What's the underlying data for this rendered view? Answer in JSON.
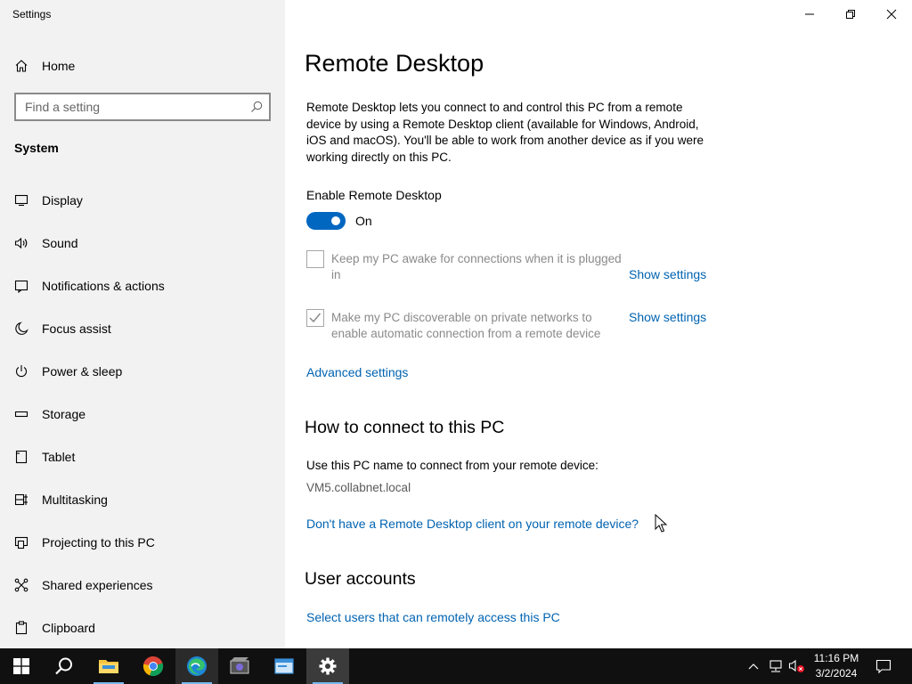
{
  "window": {
    "title": "Settings"
  },
  "sidebar": {
    "home_label": "Home",
    "search_placeholder": "Find a setting",
    "section_title": "System",
    "items": [
      {
        "label": "Display",
        "icon": "display-icon"
      },
      {
        "label": "Sound",
        "icon": "sound-icon"
      },
      {
        "label": "Notifications & actions",
        "icon": "notifications-icon"
      },
      {
        "label": "Focus assist",
        "icon": "moon-icon"
      },
      {
        "label": "Power & sleep",
        "icon": "power-icon"
      },
      {
        "label": "Storage",
        "icon": "storage-icon"
      },
      {
        "label": "Tablet",
        "icon": "tablet-icon"
      },
      {
        "label": "Multitasking",
        "icon": "multitasking-icon"
      },
      {
        "label": "Projecting to this PC",
        "icon": "projecting-icon"
      },
      {
        "label": "Shared experiences",
        "icon": "shared-experiences-icon"
      },
      {
        "label": "Clipboard",
        "icon": "clipboard-icon"
      }
    ]
  },
  "main": {
    "title": "Remote Desktop",
    "description": "Remote Desktop lets you connect to and control this PC from a remote device by using a Remote Desktop client (available for Windows, Android, iOS and macOS). You'll be able to work from another device as if you were working directly on this PC.",
    "enable_label": "Enable Remote Desktop",
    "toggle_state": "On",
    "keep_awake": {
      "text": "Keep my PC awake for connections when it is plugged in",
      "checked": false,
      "link": "Show settings"
    },
    "discoverable": {
      "text": "Make my PC discoverable on private networks to enable automatic connection from a remote device",
      "checked": true,
      "link": "Show settings"
    },
    "advanced_link": "Advanced settings",
    "connect_heading": "How to connect to this PC",
    "connect_text": "Use this PC name to connect from your remote device:",
    "pc_name": "VM5.collabnet.local",
    "client_link": "Don't have a Remote Desktop client on your remote device?",
    "accounts_heading": "User accounts",
    "accounts_link": "Select users that can remotely access this PC"
  },
  "taskbar": {
    "time": "11:16 PM",
    "date": "3/2/2024",
    "apps": [
      "start-icon",
      "search-icon",
      "file-explorer-icon",
      "chrome-icon",
      "edge-icon",
      "media-app-icon",
      "window-app-icon",
      "settings-icon"
    ]
  },
  "colors": {
    "accent": "#0067c0",
    "link": "#0063b1",
    "sidebar_bg": "#f2f2f2",
    "taskbar_bg": "#101010"
  }
}
